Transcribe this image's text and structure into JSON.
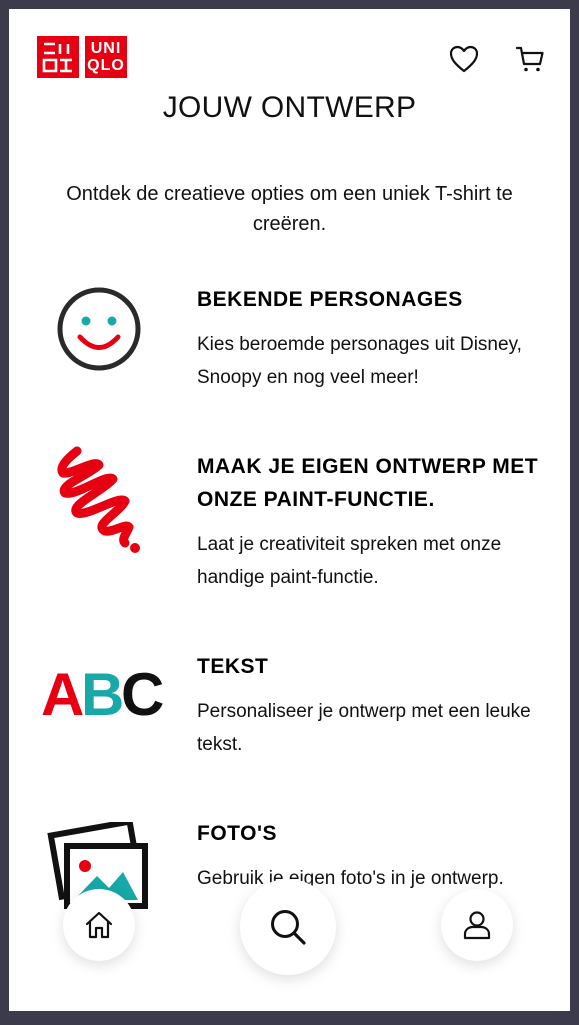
{
  "header": {
    "logo_katakana_row1": "ユニ",
    "logo_katakana_row2": "クロ",
    "logo_latin_row1": "UNI",
    "logo_latin_row2": "QLO",
    "wishlist_icon": "heart-icon",
    "cart_icon": "cart-icon"
  },
  "page": {
    "title": "JOUW ONTWERP",
    "intro": "Ontdek de creatieve opties om een uniek T-shirt te creëren."
  },
  "features": [
    {
      "title": "BEKENDE PERSONAGES",
      "description": "Kies beroemde personages uit Disney, Snoopy en nog veel meer!",
      "icon": "smiley-face-icon"
    },
    {
      "title": "MAAK JE EIGEN ONTWERP MET ONZE PAINT-FUNCTIE.",
      "description": "Laat je creativiteit spreken met onze handige paint-functie.",
      "icon": "paint-scribble-icon"
    },
    {
      "title": "TEKST",
      "description": "Personaliseer je ontwerp met een leuke tekst.",
      "icon": "abc-text-icon",
      "art_letters": [
        "A",
        "B",
        "C"
      ]
    },
    {
      "title": "FOTO'S",
      "description": "Gebruik je eigen foto's in je ontwerp.",
      "icon": "photos-icon"
    }
  ],
  "bottom_nav": {
    "home_icon": "home-icon",
    "search_icon": "search-icon",
    "account_icon": "user-icon"
  },
  "colors": {
    "brand_red": "#e60012",
    "teal": "#18a8a8",
    "backdrop": "#3c3b4c"
  }
}
